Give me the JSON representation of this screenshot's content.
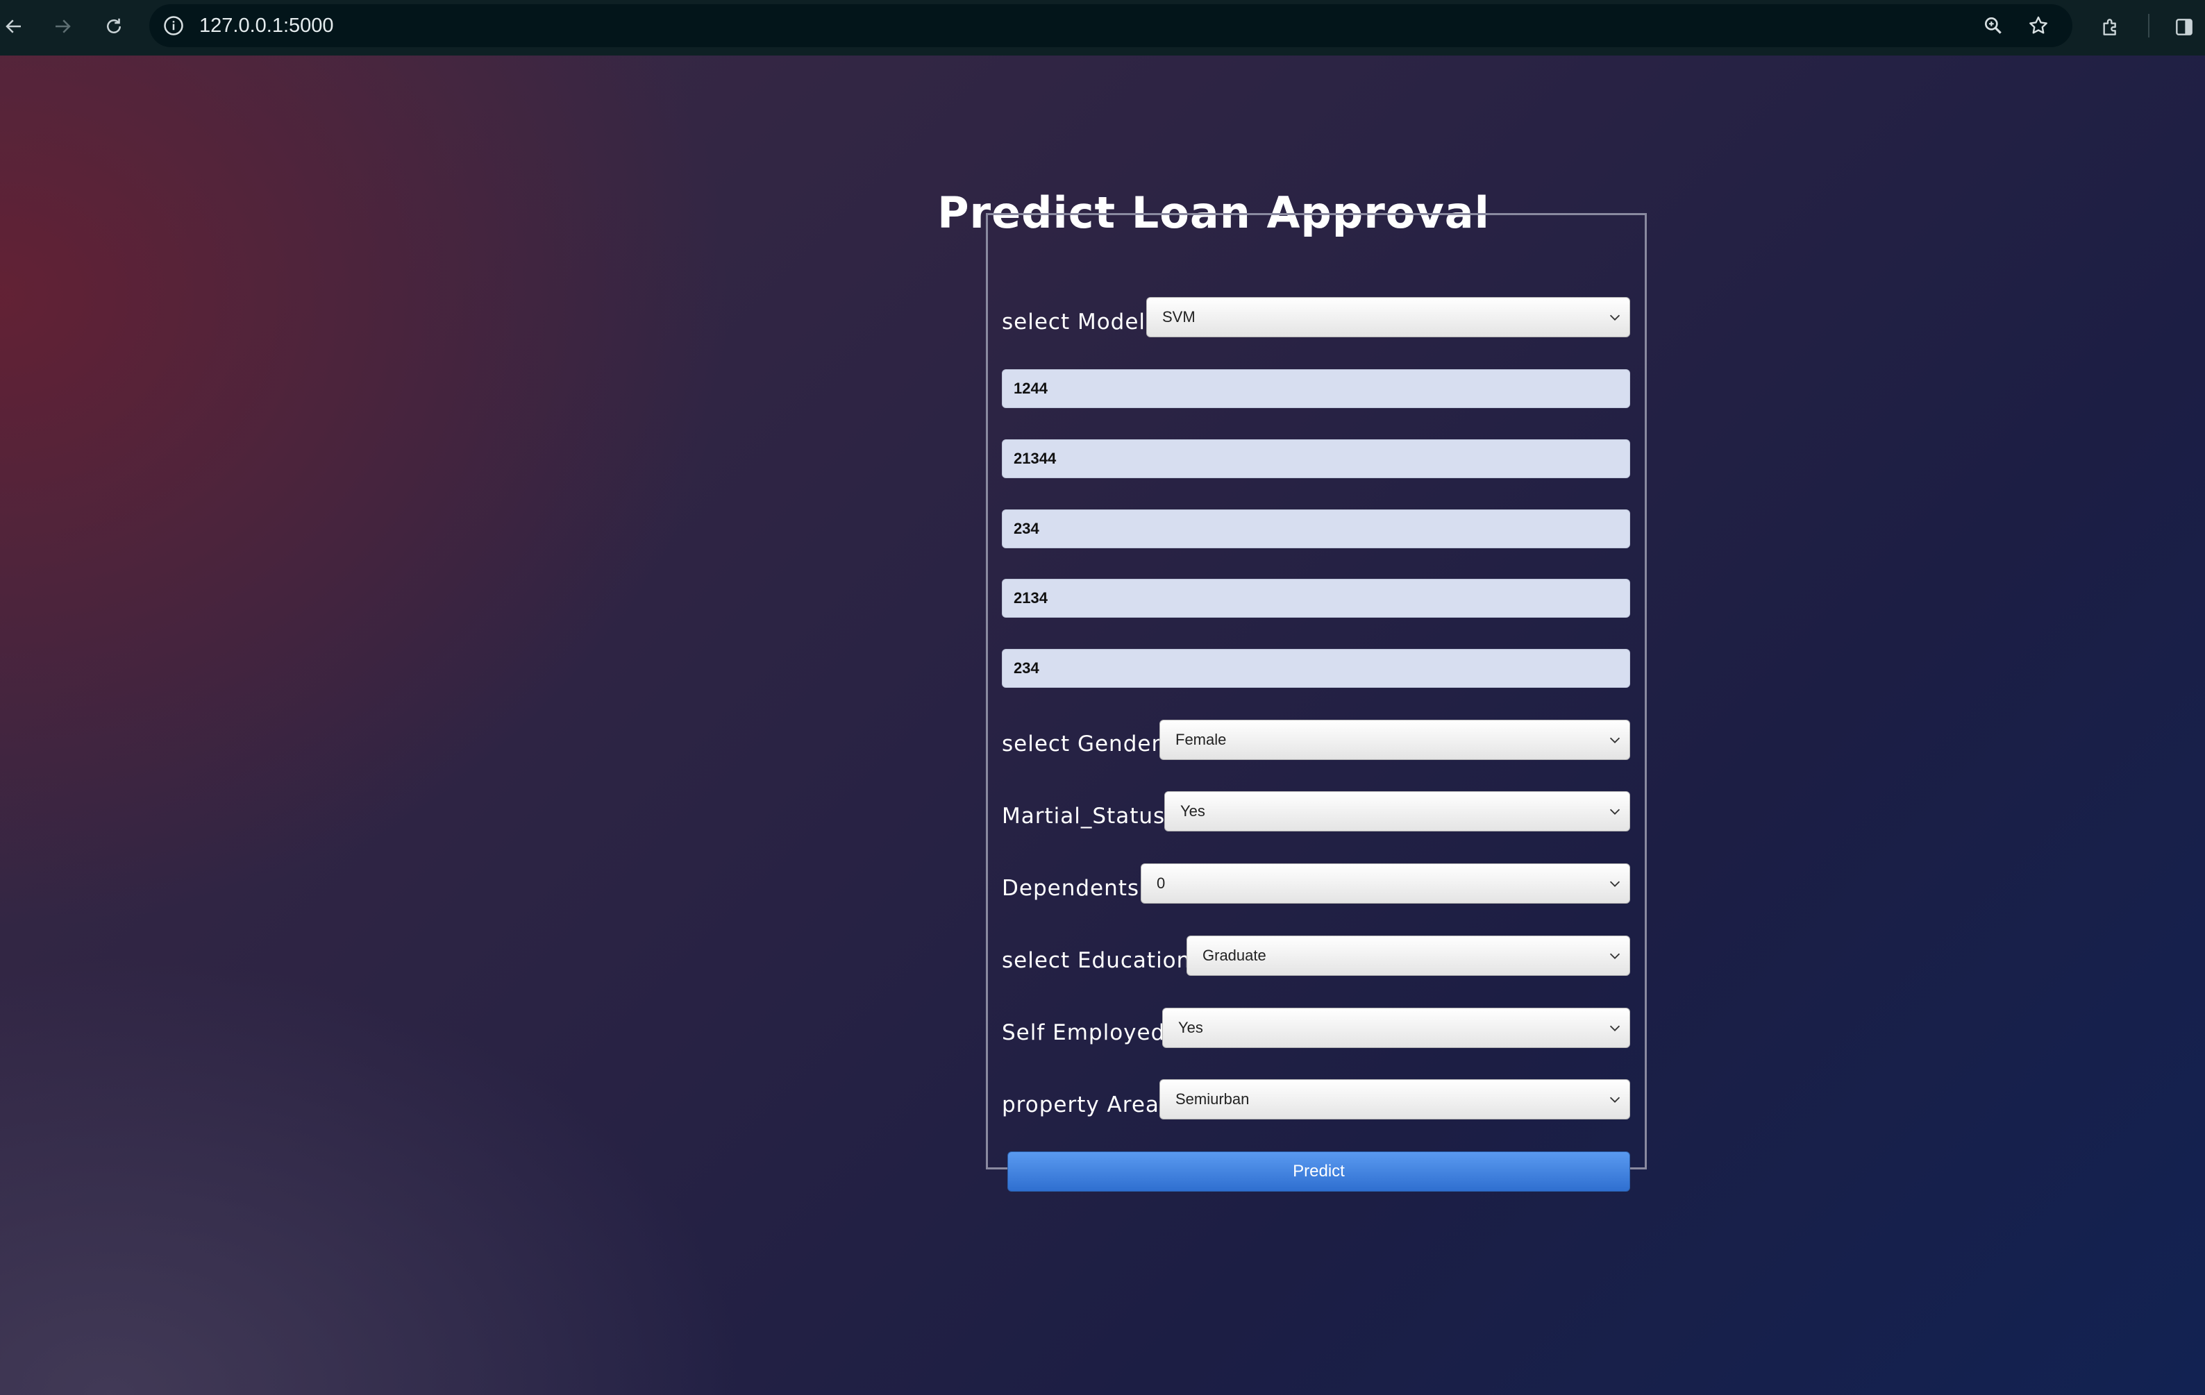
{
  "browser": {
    "url": "127.0.0.1:5000"
  },
  "page": {
    "title": "Predict Loan Approval"
  },
  "form": {
    "model": {
      "label": "select Model",
      "value": "SVM"
    },
    "numeric_inputs": [
      "1244",
      "21344",
      "234",
      "2134",
      "234"
    ],
    "gender": {
      "label": "select Gender",
      "value": "Female"
    },
    "marital_status": {
      "label": "Martial_Status",
      "value": "Yes"
    },
    "dependents": {
      "label": "Dependents",
      "value": "0"
    },
    "education": {
      "label": "select Education",
      "value": "Graduate"
    },
    "self_employed": {
      "label": "Self Employed",
      "value": "Yes"
    },
    "property_area": {
      "label": "property Area",
      "value": "Semiurban"
    },
    "submit_label": "Predict"
  }
}
